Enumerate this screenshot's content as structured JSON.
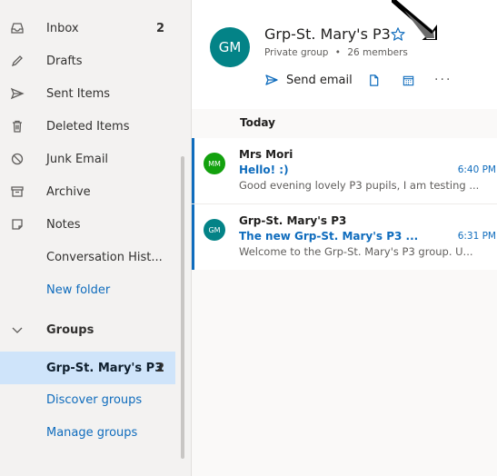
{
  "sidebar": {
    "folders": [
      {
        "label": "Inbox",
        "count": "2",
        "icon": "inbox-icon"
      },
      {
        "label": "Drafts",
        "icon": "pencil-icon"
      },
      {
        "label": "Sent Items",
        "icon": "send-icon"
      },
      {
        "label": "Deleted Items",
        "icon": "trash-icon"
      },
      {
        "label": "Junk Email",
        "icon": "blocked-icon"
      },
      {
        "label": "Archive",
        "icon": "archive-icon"
      },
      {
        "label": "Notes",
        "icon": "note-icon"
      },
      {
        "label": "Conversation Hist..."
      },
      {
        "label": "New folder"
      }
    ],
    "groups": {
      "header": "Groups",
      "items": [
        {
          "label": "Grp-St. Mary's P3",
          "count": "2"
        },
        {
          "label": "Discover groups"
        },
        {
          "label": "Manage groups"
        }
      ]
    }
  },
  "header": {
    "avatar_initials": "GM",
    "title": "Grp-St. Mary's P3",
    "privacy": "Private group",
    "separator": "•",
    "members": "26 members",
    "send_email_label": "Send email",
    "more_label": "···"
  },
  "list": {
    "day_label": "Today",
    "messages": [
      {
        "avatar": "MM",
        "sender": "Mrs Mori",
        "subject": "Hello! :)",
        "time": "6:40 PM",
        "preview": "Good evening lovely P3 pupils, I am testing ..."
      },
      {
        "avatar": "GM",
        "sender": "Grp-St. Mary's P3",
        "subject": "The new Grp-St. Mary's P3 ...",
        "time": "6:31 PM",
        "preview": "Welcome to the Grp-St. Mary's P3 group. U..."
      }
    ]
  },
  "colors": {
    "accent": "#0f6cbd",
    "group_avatar": "#038387",
    "mm_avatar": "#13a10e",
    "selected_bg": "#cfe4fa"
  }
}
